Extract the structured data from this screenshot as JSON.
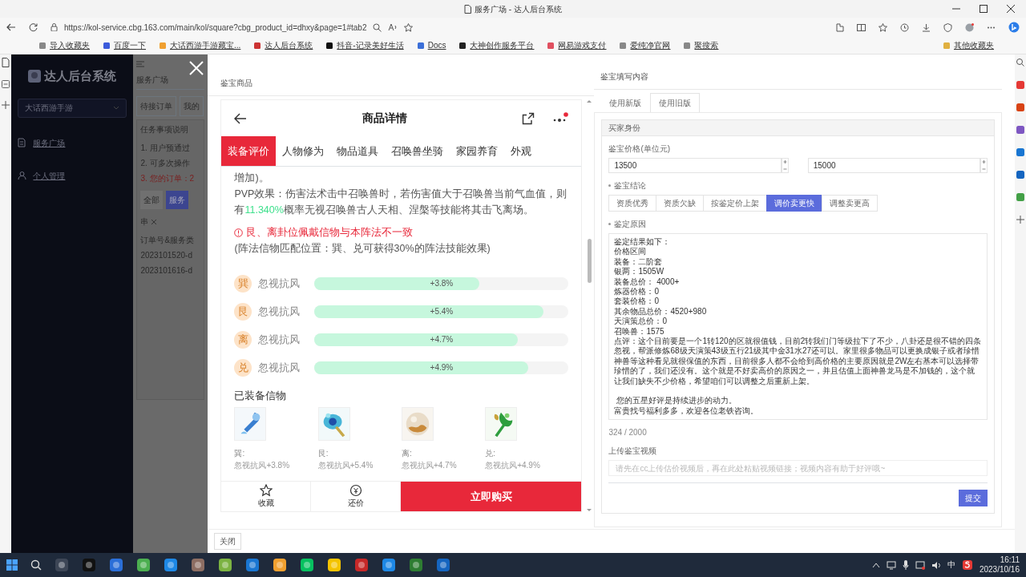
{
  "browser": {
    "tab_title": "服务广场 - 达人后台系统",
    "url": "https://kol-service.cbg.163.com/main/kol/square?cbg_product_id=dhxy&page=1#tab2",
    "bookmarks": [
      "导入收藏夹",
      "百度一下",
      "大话西游手游藏宝...",
      "达人后台系统",
      "抖音-记录美好生活",
      "Docs",
      "大神创作服务平台",
      "网易游戏支付",
      "爱纯净官网",
      "聚搜索",
      "其他收藏夹"
    ]
  },
  "sidebar": {
    "logo": "达人后台系统",
    "game_select": "大话西游手游",
    "items": [
      "服务广场",
      "个人管理"
    ]
  },
  "background_page": {
    "title": "服务广场",
    "tabs": [
      "待接订单",
      "我的"
    ],
    "notice_title": "任务事项说明",
    "notice_lines": [
      {
        "text": "1. 用户预通过",
        "warn": false
      },
      {
        "text": "2. 可多次操作",
        "warn": false
      },
      {
        "text": "3. 您的订单：2",
        "warn": true
      }
    ],
    "filters": [
      {
        "label": "全部",
        "selected": false
      },
      {
        "label": "服务",
        "selected": true
      }
    ],
    "select": "串",
    "table_header": "订单号&服务类",
    "rows": [
      "2023101520-d",
      "2023101616-d"
    ]
  },
  "product_panel": {
    "title": "鉴宝商品",
    "header": "商品详情",
    "tabs": [
      {
        "label": "装备评价",
        "selected": true
      },
      {
        "label": "人物修为",
        "selected": false
      },
      {
        "label": "物品道具",
        "selected": false
      },
      {
        "label": "召唤兽坐骑",
        "selected": false
      },
      {
        "label": "家园养育",
        "selected": false
      },
      {
        "label": "外观",
        "selected": false
      }
    ],
    "intro_tail": "增加)。",
    "pvp": {
      "before": "PVP效果：伤害法术击中召唤兽时，若伤害值大于召唤兽当前气血值，则有",
      "highlight": "11.340%",
      "after": "概率无视召唤兽古人天相、涅槃等技能将其击飞离场。"
    },
    "warning": "艮、离卦位佩戴信物与本阵法不一致",
    "match_note": "(阵法信物匹配位置：巽、兑可获得30%的阵法技能效果)",
    "bonuses": [
      {
        "trigram": "巽",
        "name": "忽视抗风",
        "value": "+3.8%",
        "level": 0.65
      },
      {
        "trigram": "艮",
        "name": "忽视抗风",
        "value": "+5.4%",
        "level": 0.9
      },
      {
        "trigram": "离",
        "name": "忽视抗风",
        "value": "+4.7%",
        "level": 0.8
      },
      {
        "trigram": "兑",
        "name": "忽视抗风",
        "value": "+4.9%",
        "level": 0.84
      }
    ],
    "relics_title": "已装备信物",
    "relics": [
      {
        "position": "巽:",
        "effect": "忽视抗风+3.8%",
        "kind": "picture"
      },
      {
        "position": "艮:",
        "effect": "忽视抗风+5.4%",
        "kind": "picture"
      },
      {
        "position": "离:",
        "effect": "忽视抗风+4.7%",
        "kind": "picture"
      },
      {
        "position": "兑:",
        "effect": "忽视抗风+4.9%",
        "kind": "picture"
      }
    ],
    "actions": [
      "收藏",
      "还价"
    ],
    "buy": "立即购买"
  },
  "appraisal_panel": {
    "title": "鉴宝填写内容",
    "tabs": [
      {
        "label": "使用新版",
        "selected": false
      },
      {
        "label": "使用旧版",
        "selected": true
      }
    ],
    "section": "买家身份",
    "price_label": "鉴宝价格(单位元)",
    "prices": [
      "13500",
      "15000"
    ],
    "conclusion_label": "鉴宝结论",
    "conclusions": [
      {
        "label": "资质优秀",
        "selected": false
      },
      {
        "label": "资质欠缺",
        "selected": false
      },
      {
        "label": "按鉴定价上架",
        "selected": false
      },
      {
        "label": "调价卖更快",
        "selected": true
      },
      {
        "label": "调整卖更高",
        "selected": false
      }
    ],
    "reason_label": "鉴定原因",
    "reason_lines": [
      {
        "text": "鉴定结果如下：",
        "spaced": false
      },
      {
        "text": "价格区间",
        "spaced": false
      },
      {
        "text": "装备：二阶套",
        "spaced": false
      },
      {
        "text": "银两：1505W",
        "spaced": false
      },
      {
        "text": "装备总价： 4000+",
        "spaced": false
      },
      {
        "text": "炼器价格：0",
        "spaced": false
      },
      {
        "text": "套装价格：0",
        "spaced": false
      },
      {
        "text": "其余物品总价：4520+980",
        "spaced": false
      },
      {
        "text": "天演策总价：0",
        "spaced": false
      },
      {
        "text": "召唤兽：1575",
        "spaced": false
      },
      {
        "text": "点评：这个目前要是一个1转120的区就很值钱，目前2转我们门等级拉下了不少，八卦还是很不错的四条忽视，帮派修炼68级天演策43级五行21级其中金31水27还可以。家里很多物品可以更换成银子或者珍惜神兽等这种看见就很保值的东西，目前很多人都不会给到高价格的主要原因就是2W左右基本可以选择带珍惜的了，我们还没有。这个就是不好卖高价的原因之一，并且估值上面神兽龙马是不加钱的，这个就让我们缺失不少价格，希望咱们可以调整之后重新上架。",
        "spaced": false
      },
      {
        "text": " 您的五星好评是持续进步的动力。",
        "spaced": true
      },
      {
        "text": "富贵找号福利多多，欢迎各位老铁咨询。",
        "spaced": false
      }
    ],
    "counter": "324 / 2000",
    "video_label": "上传鉴宝视频",
    "video_placeholder": "请先在cc上传估价视频后，再在此处粘贴视频链接；视频内容有助于好评哦~",
    "submit": "提交"
  },
  "footer_close": "关闭",
  "taskbar": {
    "ime": "中",
    "time": "16:11",
    "date": "2023/10/16"
  }
}
